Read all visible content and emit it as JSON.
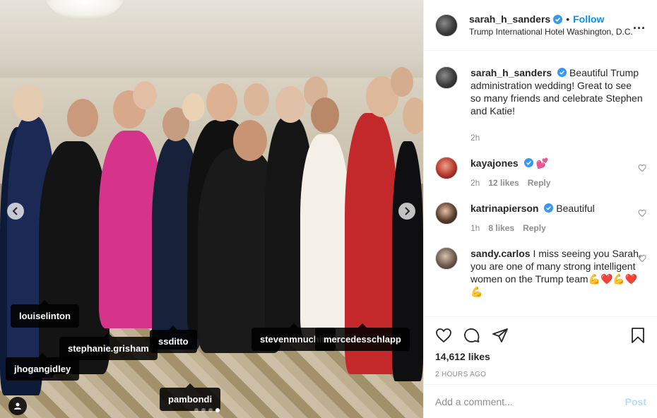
{
  "header": {
    "username": "sarah_h_sanders",
    "separator": "•",
    "follow_label": "Follow",
    "location": "Trump International Hotel Washington, D.C.",
    "more_label": "..."
  },
  "photo": {
    "tags": [
      "louiselinton",
      "stephanie.grisham",
      "ssditto",
      "stevenmnuchin",
      "mercedesschlapp",
      "jhogangidley",
      "pambondi"
    ],
    "carousel": {
      "current": 4,
      "total": 4
    },
    "icons": [
      "chevron-left-icon",
      "chevron-right-icon",
      "user-tag-icon"
    ]
  },
  "caption": {
    "username": "sarah_h_sanders",
    "text": "Beautiful Trump administration wedding! Great to see so many friends and celebrate Stephen and Katie!",
    "time": "2h"
  },
  "comments": [
    {
      "username": "kayajones",
      "text": "💕",
      "time": "2h",
      "likes": "12 likes",
      "reply": "Reply"
    },
    {
      "username": "katrinapierson",
      "text": "Beautiful",
      "time": "1h",
      "likes": "8 likes",
      "reply": "Reply"
    },
    {
      "username": "sandy.carlos",
      "text": "I miss seeing you Sarah, you are one of many strong intelligent women on the Trump team💪❤️💪❤️💪",
      "time": "",
      "likes": "",
      "reply": ""
    }
  ],
  "actions": {
    "likes": "14,612 likes",
    "timestamp": "2 HOURS AGO",
    "icons": [
      "heart-icon",
      "comment-icon",
      "share-icon",
      "bookmark-icon"
    ]
  },
  "add_comment": {
    "placeholder": "Add a comment...",
    "post_label": "Post"
  },
  "colors": {
    "accent": "#0095f6",
    "post_disabled": "#b2dffc",
    "muted": "#8e8e8e",
    "text": "#262626"
  }
}
